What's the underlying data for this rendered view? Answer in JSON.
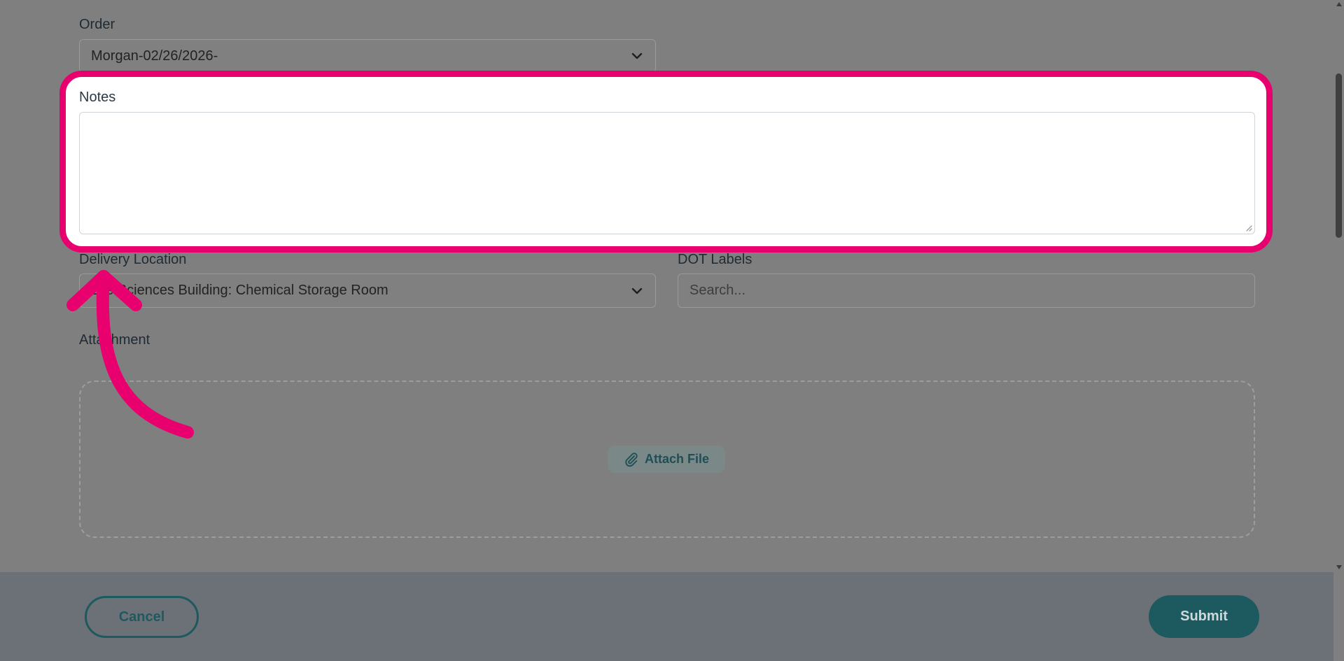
{
  "form": {
    "order": {
      "label": "Order",
      "value": "Morgan-02/26/2026-"
    },
    "notes": {
      "label": "Notes",
      "value": ""
    },
    "delivery_location": {
      "label": "Delivery Location",
      "value": "Life Sciences Building: Chemical Storage Room"
    },
    "dot_labels": {
      "label": "DOT Labels",
      "placeholder": "Search..."
    },
    "attachment": {
      "label": "Attachment",
      "attach_button_label": "Attach File"
    }
  },
  "footer": {
    "cancel_label": "Cancel",
    "submit_label": "Submit"
  },
  "annotation": {
    "highlight_color": "#e8006f",
    "target": "notes"
  },
  "icons": {
    "dropdown": "chevron-down-icon",
    "attach": "paperclip-icon",
    "resize": "resize-grip-icon"
  },
  "colors": {
    "primary": "#1d5a60",
    "overlay": "#7f7f7f",
    "highlight": "#e8006f"
  }
}
